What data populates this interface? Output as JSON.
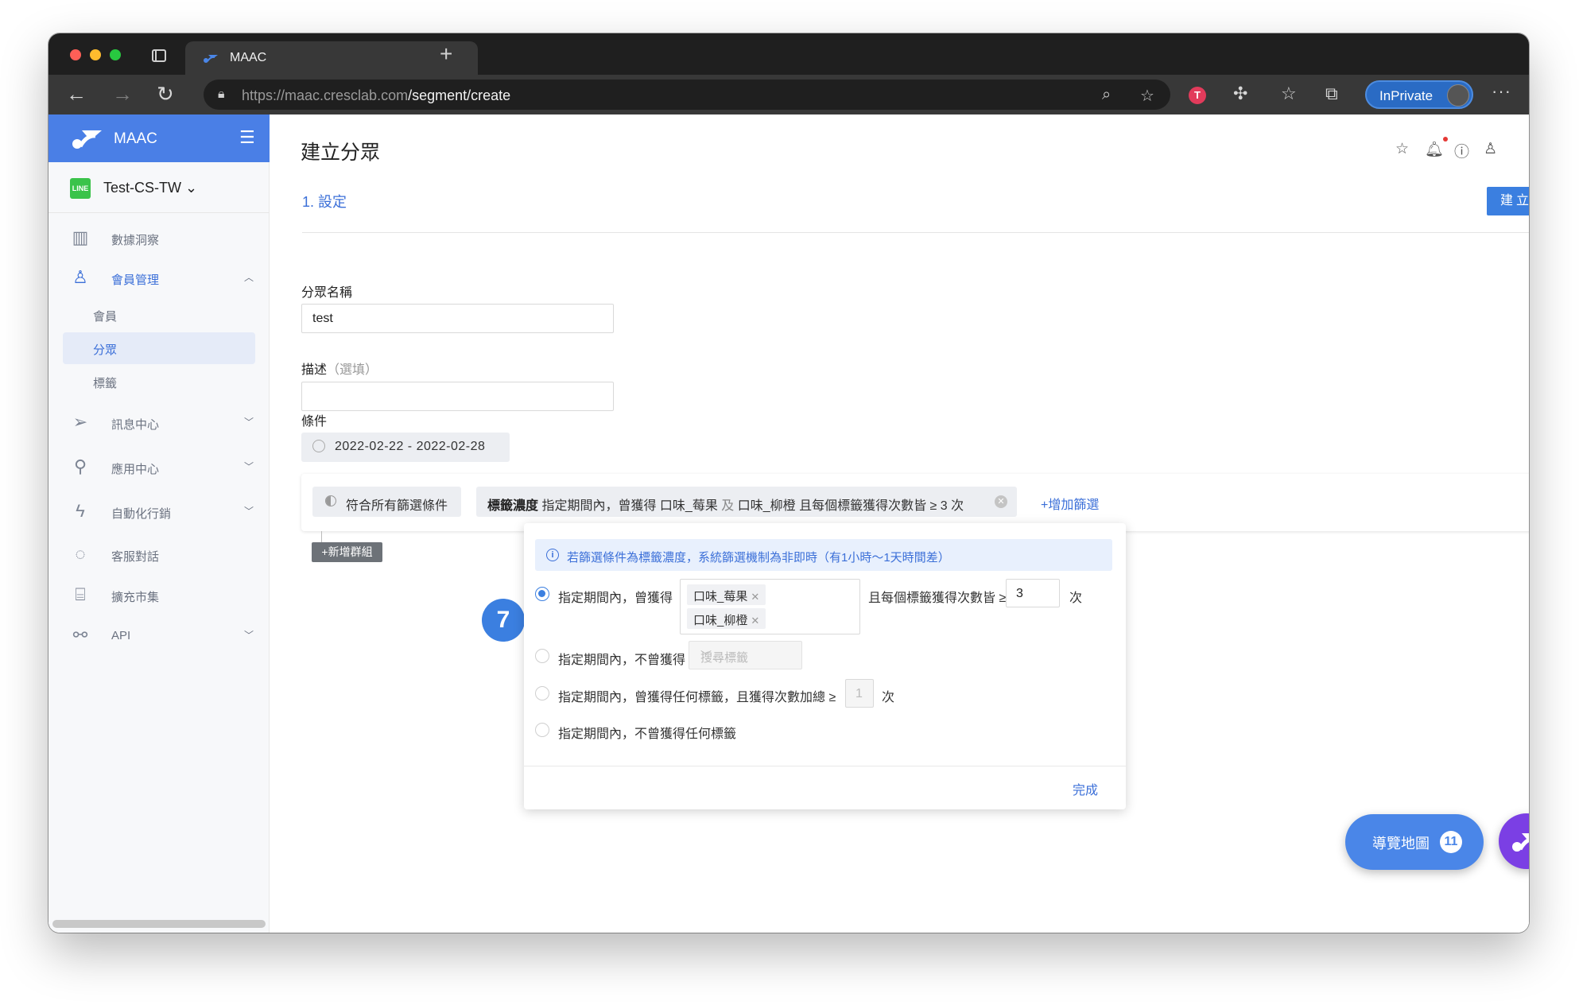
{
  "browser": {
    "tab_title": "MAAC",
    "url_host": "https://maac.cresclab.com",
    "url_path": "/segment/create",
    "inprivate_label": "InPrivate"
  },
  "sidebar": {
    "brand": "MAAC",
    "account": "Test-CS-TW",
    "line_badge": "LINE",
    "items": [
      {
        "label": "數據洞察"
      },
      {
        "label": "會員管理"
      },
      {
        "label": "訊息中心"
      },
      {
        "label": "應用中心"
      },
      {
        "label": "自動化行銷"
      },
      {
        "label": "客服對話"
      },
      {
        "label": "擴充市集"
      },
      {
        "label": "API"
      }
    ],
    "sub_items": [
      {
        "label": "會員"
      },
      {
        "label": "分眾"
      },
      {
        "label": "標籤"
      }
    ]
  },
  "main": {
    "title": "建立分眾",
    "step": "1. 設定",
    "create_button": "建立",
    "name_label": "分眾名稱",
    "name_value": "test",
    "desc_label": "描述",
    "desc_optional": "（選填）",
    "desc_value": "",
    "condition_label": "條件",
    "date_range": "2022-02-22 - 2022-02-28",
    "match_all": "符合所有篩選條件",
    "chip_type": "標籤濃度",
    "chip_text_1": "指定期間內，曾獲得 口味_莓果",
    "chip_and": "及",
    "chip_text_2": "口味_柳橙 且每個標籤獲得次數皆 ≥ 3 次",
    "add_filter": "+增加篩選",
    "add_group": "+新增群組"
  },
  "popover": {
    "info": "若篩選條件為標籤濃度，系統篩選機制為非即時（有1小時～1天時間差）",
    "option1_label": "指定期間內，曾獲得",
    "tags": [
      "口味_莓果",
      "口味_柳橙"
    ],
    "option1_suffix": "且每個標籤獲得次數皆 ≥",
    "option1_count": "3",
    "times": "次",
    "option2_label": "指定期間內，不曾獲得",
    "option2_placeholder": "搜尋標籤",
    "option3_label": "指定期間內，曾獲得任何標籤，且獲得次數加總 ≥",
    "option3_count": "1",
    "option4_label": "指定期間內，不曾獲得任何標籤",
    "done": "完成",
    "selected_option": 1
  },
  "step_badge": "7",
  "tour": {
    "label": "導覽地圖",
    "count": "11"
  },
  "colors": {
    "brand_blue": "#4a7fe6",
    "accent_blue": "#3b6fd8",
    "chat_purple": "#7b3fe4"
  }
}
